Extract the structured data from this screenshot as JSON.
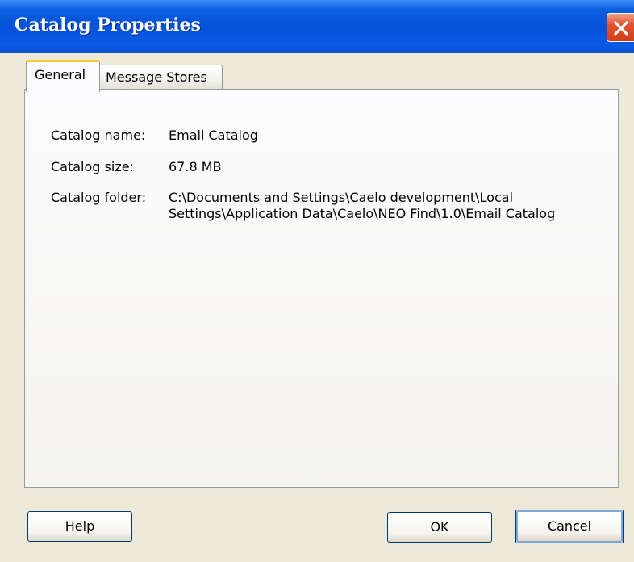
{
  "window": {
    "title": "Catalog Properties"
  },
  "tabs": [
    {
      "label": "General",
      "selected": true
    },
    {
      "label": "Message Stores",
      "selected": false
    }
  ],
  "properties": {
    "name_label": "Catalog name:",
    "name_value": "Email Catalog",
    "size_label": "Catalog size:",
    "size_value": "67.8 MB",
    "folder_label": "Catalog folder:",
    "folder_value_line1": "C:\\Documents and Settings\\Caelo development\\Local",
    "folder_value_line2": "Settings\\Application Data\\Caelo\\NEO Find\\1.0\\Email Catalog"
  },
  "buttons": {
    "help": "Help",
    "ok": "OK",
    "cancel": "Cancel"
  },
  "icons": {
    "close": "close-icon"
  },
  "colors": {
    "titlebar": "#0652d8",
    "dialog_bg": "#ece9d8",
    "close_button": "#e2542e",
    "tab_highlight": "#ffc83c"
  }
}
